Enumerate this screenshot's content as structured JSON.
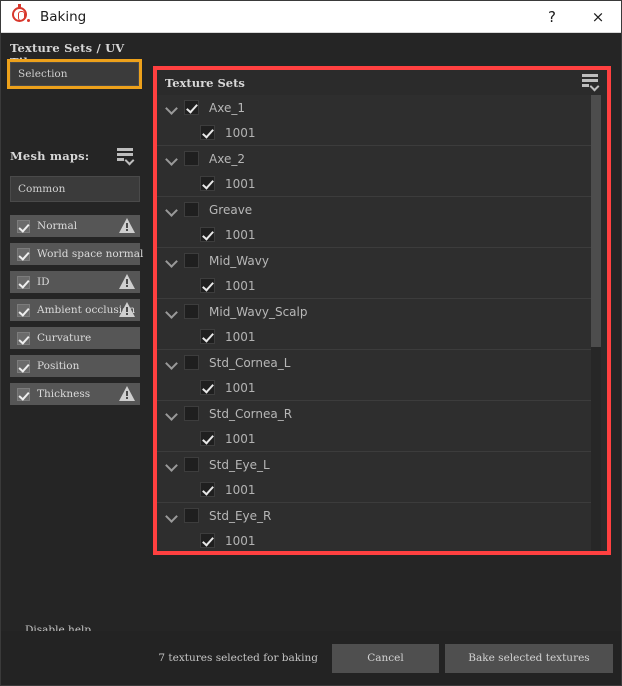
{
  "window": {
    "title": "Baking",
    "app_icon": "substance-painter-icon",
    "help_label": "?",
    "close_label": "×"
  },
  "left_panel": {
    "texture_sets_uv_title": "Texture Sets / UV Tiles",
    "selection_value": "Selection",
    "mesh_maps_title": "Mesh maps:",
    "mesh_maps_menu_icon": "list-menu-icon",
    "common_value": "Common",
    "mesh_maps": [
      {
        "label": "Normal",
        "checked": true,
        "warning": true
      },
      {
        "label": "World space normal",
        "checked": true,
        "warning": false
      },
      {
        "label": "ID",
        "checked": true,
        "warning": true
      },
      {
        "label": "Ambient occlusion",
        "checked": true,
        "warning": true
      },
      {
        "label": "Curvature",
        "checked": true,
        "warning": false
      },
      {
        "label": "Position",
        "checked": true,
        "warning": false
      },
      {
        "label": "Thickness",
        "checked": true,
        "warning": true
      }
    ],
    "disable_help_label": "Disable help"
  },
  "texture_sets_panel": {
    "header_title": "Texture Sets",
    "header_menu_icon": "list-menu-icon",
    "highlight_color": "#ff4040",
    "groups": [
      {
        "name": "Axe_1",
        "checked": true,
        "expanded": true,
        "children": [
          {
            "label": "1001",
            "checked": true
          }
        ]
      },
      {
        "name": "Axe_2",
        "checked": false,
        "expanded": true,
        "children": [
          {
            "label": "1001",
            "checked": true
          }
        ]
      },
      {
        "name": "Greave",
        "checked": false,
        "expanded": true,
        "children": [
          {
            "label": "1001",
            "checked": true
          }
        ]
      },
      {
        "name": "Mid_Wavy",
        "checked": false,
        "expanded": true,
        "children": [
          {
            "label": "1001",
            "checked": true
          }
        ]
      },
      {
        "name": "Mid_Wavy_Scalp",
        "checked": false,
        "expanded": true,
        "children": [
          {
            "label": "1001",
            "checked": true
          }
        ]
      },
      {
        "name": "Std_Cornea_L",
        "checked": false,
        "expanded": true,
        "children": [
          {
            "label": "1001",
            "checked": true
          }
        ]
      },
      {
        "name": "Std_Cornea_R",
        "checked": false,
        "expanded": true,
        "children": [
          {
            "label": "1001",
            "checked": true
          }
        ]
      },
      {
        "name": "Std_Eye_L",
        "checked": false,
        "expanded": true,
        "children": [
          {
            "label": "1001",
            "checked": true
          }
        ]
      },
      {
        "name": "Std_Eye_R",
        "checked": false,
        "expanded": true,
        "children": [
          {
            "label": "1001",
            "checked": true
          }
        ]
      }
    ]
  },
  "footer": {
    "status_text": "7 textures selected for baking",
    "cancel_label": "Cancel",
    "bake_label": "Bake selected textures"
  },
  "colors": {
    "selection_highlight": "#eda11b",
    "annotation": "#ff4040",
    "panel_bg": "#252525",
    "list_bg": "#2e2e2e"
  }
}
